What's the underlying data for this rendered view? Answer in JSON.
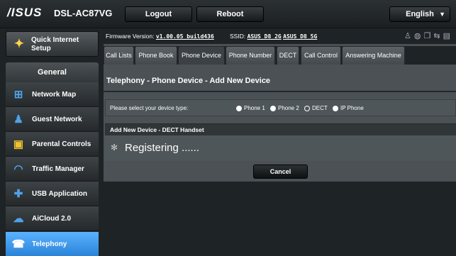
{
  "header": {
    "brand": "/ISUS",
    "model": "DSL-AC87VG",
    "logout_label": "Logout",
    "reboot_label": "Reboot",
    "language": "English"
  },
  "sidebar": {
    "quick_setup": {
      "label_line1": "Quick Internet",
      "label_line2": "Setup",
      "icon": "wand-icon"
    },
    "section_title": "General",
    "items": [
      {
        "label": "Network Map",
        "icon": "network-map-icon"
      },
      {
        "label": "Guest Network",
        "icon": "guest-network-icon"
      },
      {
        "label": "Parental Controls",
        "icon": "lock-icon"
      },
      {
        "label": "Traffic Manager",
        "icon": "speedometer-icon"
      },
      {
        "label": "USB Application",
        "icon": "puzzle-icon"
      },
      {
        "label": "AiCloud 2.0",
        "icon": "cloud-icon"
      },
      {
        "label": "Telephony",
        "icon": "phone-icon",
        "active": true
      }
    ]
  },
  "info": {
    "firmware_label": "Firmware Version:",
    "firmware_value": "v1.00.05_build436",
    "ssid_label": "SSID:",
    "ssid_2g": "ASUS_D8_2G",
    "ssid_5g": "ASUS_D8_5G"
  },
  "tabs": [
    {
      "label": "Call Lists"
    },
    {
      "label": "Phone Book"
    },
    {
      "label": "Phone Device",
      "active": true
    },
    {
      "label": "Phone Number"
    },
    {
      "label": "DECT"
    },
    {
      "label": "Call Control"
    },
    {
      "label": "Answering Machine"
    }
  ],
  "page": {
    "title": "Telephony - Phone Device - Add New Device",
    "device_type_label": "Please select your device type:",
    "device_types": [
      "Phone 1",
      "Phone 2",
      "DECT",
      "IP Phone"
    ],
    "selected_device_type": "DECT",
    "section_title": "Add New Device - DECT Handset",
    "status_text": "Registering ......",
    "cancel_label": "Cancel"
  },
  "colors": {
    "accent": "#3b9cf3",
    "background": "#1e2325",
    "panel": "#4b5154"
  }
}
